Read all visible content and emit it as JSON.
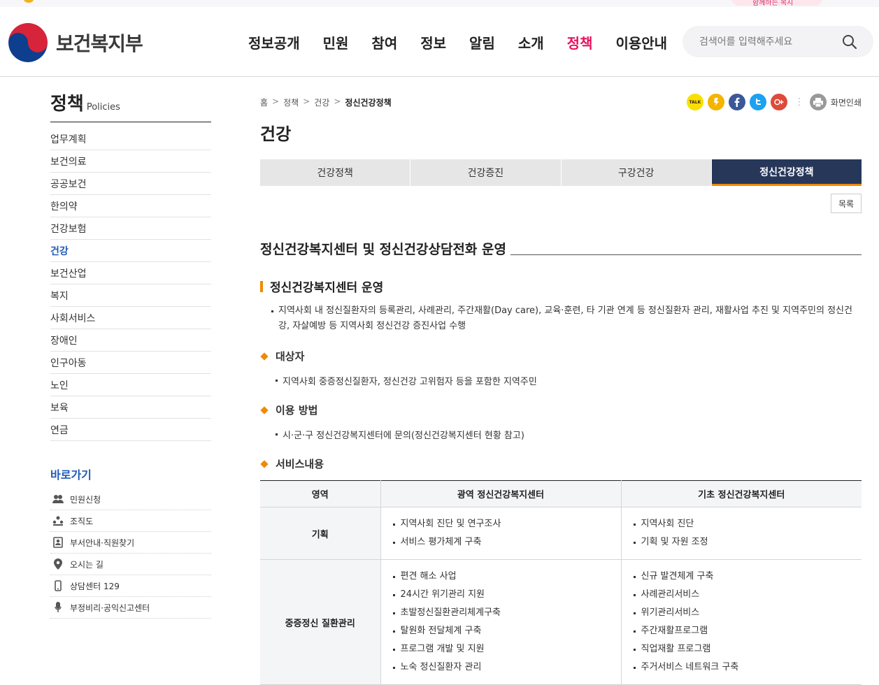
{
  "header": {
    "logo_text": "보건복지부",
    "promo_text": "함께하는 복지",
    "nav": [
      "정보공개",
      "민원",
      "참여",
      "정보",
      "알림",
      "소개",
      "정책",
      "이용안내"
    ],
    "search_placeholder": "검색어를 입력해주세요"
  },
  "sidebar": {
    "title": "정책",
    "title_en": "Policies",
    "items": [
      "업무계획",
      "보건의료",
      "공공보건",
      "한의약",
      "건강보험",
      "건강",
      "보건산업",
      "복지",
      "사회서비스",
      "장애인",
      "인구아동",
      "노인",
      "보육",
      "연금"
    ],
    "active_item": "건강",
    "quick_title": "바로가기",
    "quick": [
      {
        "label": "민원신청",
        "icon": "people-icon"
      },
      {
        "label": "조직도",
        "icon": "org-chart-icon"
      },
      {
        "label": "부서안내·직원찾기",
        "icon": "contact-book-icon"
      },
      {
        "label": "오시는 길",
        "icon": "location-pin-icon"
      },
      {
        "label": "상담센터 129",
        "icon": "mobile-phone-icon"
      },
      {
        "label": "부정비리·공익신고센터",
        "icon": "microphone-icon"
      }
    ]
  },
  "breadcrumb": [
    "홈",
    "정책",
    "건강",
    "정신건강정책"
  ],
  "share": {
    "print_label": "화면인쇄",
    "kakao_talk_label": "TALK",
    "icons": [
      "kakaotalk-icon",
      "kakaostory-icon",
      "facebook-icon",
      "twitter-icon",
      "google-plus-icon",
      "print-icon"
    ]
  },
  "page_title": "건강",
  "tabs": [
    "건강정책",
    "건강증진",
    "구강건강",
    "정신건강정책"
  ],
  "active_tab": "정신건강정책",
  "list_button": "목록",
  "content": {
    "section_title": "정신건강복지센터 및 정신건강상담전화 운영",
    "sub_title": "정신건강복지센터 운영",
    "description": "지역사회 내 정신질환자의 등록관리, 사례관리, 주간재활(Day care), 교육·훈련, 타 기관 연계 등 정신질환자 관리, 재활사업 추진 및 지역주민의 정신건강, 자살예방 등 지역사회 정신건강 증진사업 수행",
    "target_heading": "대상자",
    "target_text": "지역사회 중증정신질환자, 정신건강 고위험자 등을 포함한 지역주민",
    "usage_heading": "이용 방법",
    "usage_text": "시·군·구 정신건강복지센터에 문의(정신건강복지센터 현황 참고)",
    "service_heading": "서비스내용"
  },
  "table": {
    "headers": [
      "영역",
      "광역 정신건강복지센터",
      "기초 정신건강복지센터"
    ],
    "rows": [
      {
        "area": "기획",
        "wide": [
          "지역사회 진단 및 연구조사",
          "서비스 평가체계 구축"
        ],
        "basic": [
          "지역사회 진단",
          "기획 및 자원 조정"
        ]
      },
      {
        "area": "중증정신 질환관리",
        "wide": [
          "편견 해소 사업",
          "24시간 위기관리 지원",
          "초발정신질환관리체계구축",
          "탈원화 전달체계 구축",
          "프로그램 개발 및 지원",
          "노숙 정신질환자 관리"
        ],
        "basic": [
          "신규 발견체계 구축",
          "사례관리서비스",
          "위기관리서비스",
          "주간재활프로그램",
          "직업재활 프로그램",
          "주거서비스 네트워크 구축"
        ]
      }
    ]
  }
}
